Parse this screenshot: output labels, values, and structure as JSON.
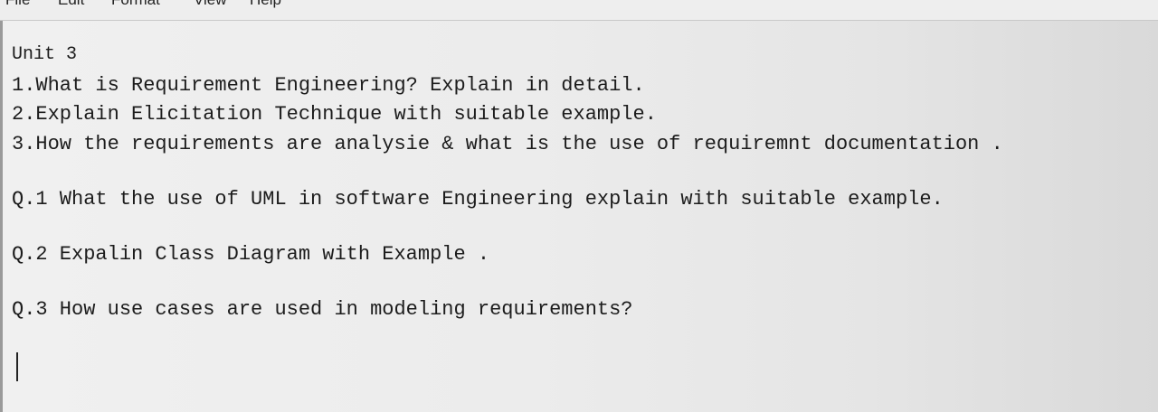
{
  "menu": {
    "file": "File",
    "edit": "Edit",
    "format": "Format",
    "view": "View",
    "help": "Help"
  },
  "document": {
    "lines": [
      "Unit 3",
      "1.What is Requirement Engineering? Explain in detail.",
      "2.Explain Elicitation Technique with suitable example.",
      "3.How the requirements are analysie & what is the use of requiremnt documentation .",
      "Q.1 What the use of UML in software Engineering explain with suitable example.",
      "Q.2 Expalin Class Diagram with Example .",
      "Q.3 How use cases are used in modeling requirements?"
    ]
  }
}
